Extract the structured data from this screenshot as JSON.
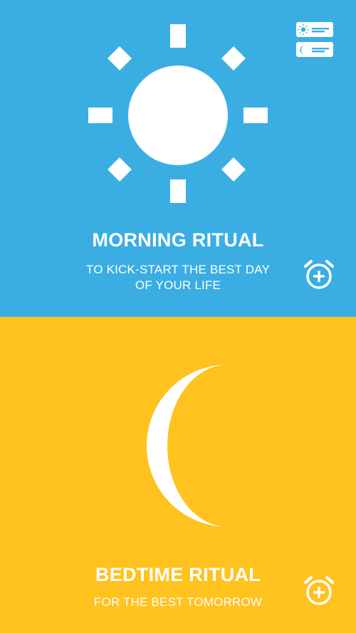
{
  "colors": {
    "morning_bg": "#3aaee2",
    "bedtime_bg": "#ffc21f",
    "foreground": "#ffffff"
  },
  "header": {
    "list_toggle_icon": "ritual-list-icon"
  },
  "morning": {
    "icon": "sun-icon",
    "title": "MORNING RITUAL",
    "subtitle_line1": "TO KICK-START THE BEST DAY",
    "subtitle_line2": "OF YOUR LIFE",
    "add_alarm_icon": "alarm-add-icon"
  },
  "bedtime": {
    "icon": "moon-icon",
    "title": "BEDTIME RITUAL",
    "subtitle": "FOR THE BEST TOMORROW",
    "add_alarm_icon": "alarm-add-icon"
  }
}
